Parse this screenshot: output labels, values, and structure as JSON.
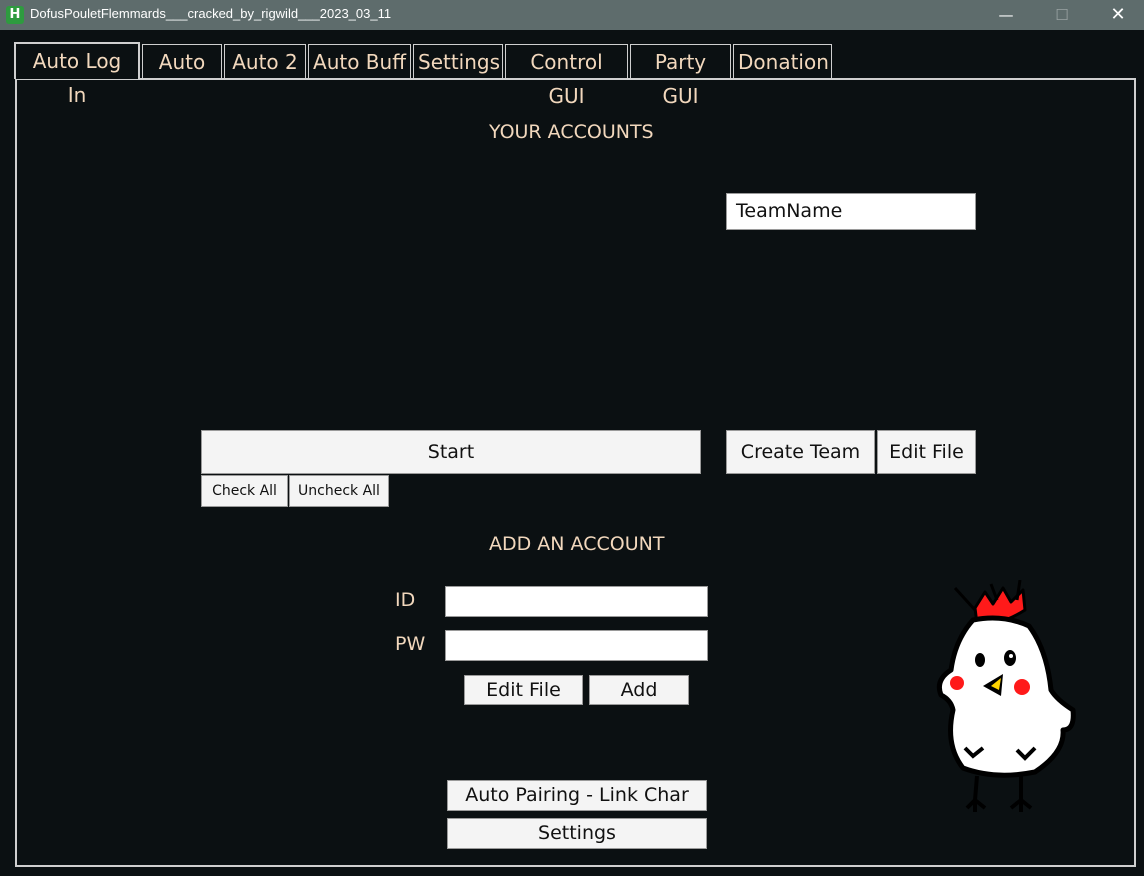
{
  "window": {
    "title": "DofusPouletFlemmards___cracked_by_rigwild___2023_03_11",
    "app_icon_letter": "H",
    "minimize": "—",
    "maximize": "☐",
    "close": "✕"
  },
  "tabs": [
    {
      "label": "Auto Log In",
      "active": true
    },
    {
      "label": "Auto"
    },
    {
      "label": "Auto 2"
    },
    {
      "label": "Auto Buff"
    },
    {
      "label": "Settings"
    },
    {
      "label": "Control GUI"
    },
    {
      "label": "Party GUI"
    },
    {
      "label": "Donation"
    }
  ],
  "accounts": {
    "heading": "YOUR ACCOUNTS",
    "team_name_value": "TeamName",
    "start_label": "Start",
    "check_all_label": "Check All",
    "uncheck_all_label": "Uncheck All",
    "create_team_label": "Create Team",
    "edit_file_label": "Edit File"
  },
  "add_account": {
    "heading": "ADD AN ACCOUNT",
    "id_label": "ID",
    "pw_label": "PW",
    "id_value": "",
    "pw_value": "",
    "edit_file_label": "Edit File",
    "add_label": "Add"
  },
  "footer": {
    "auto_pairing_label": "Auto Pairing - Link Char",
    "settings_label": "Settings"
  },
  "colors": {
    "background": "#0b1012",
    "titlebar": "#5e6c6c",
    "text_accent": "#f2d8bd",
    "button_bg": "#f4f4f4"
  }
}
